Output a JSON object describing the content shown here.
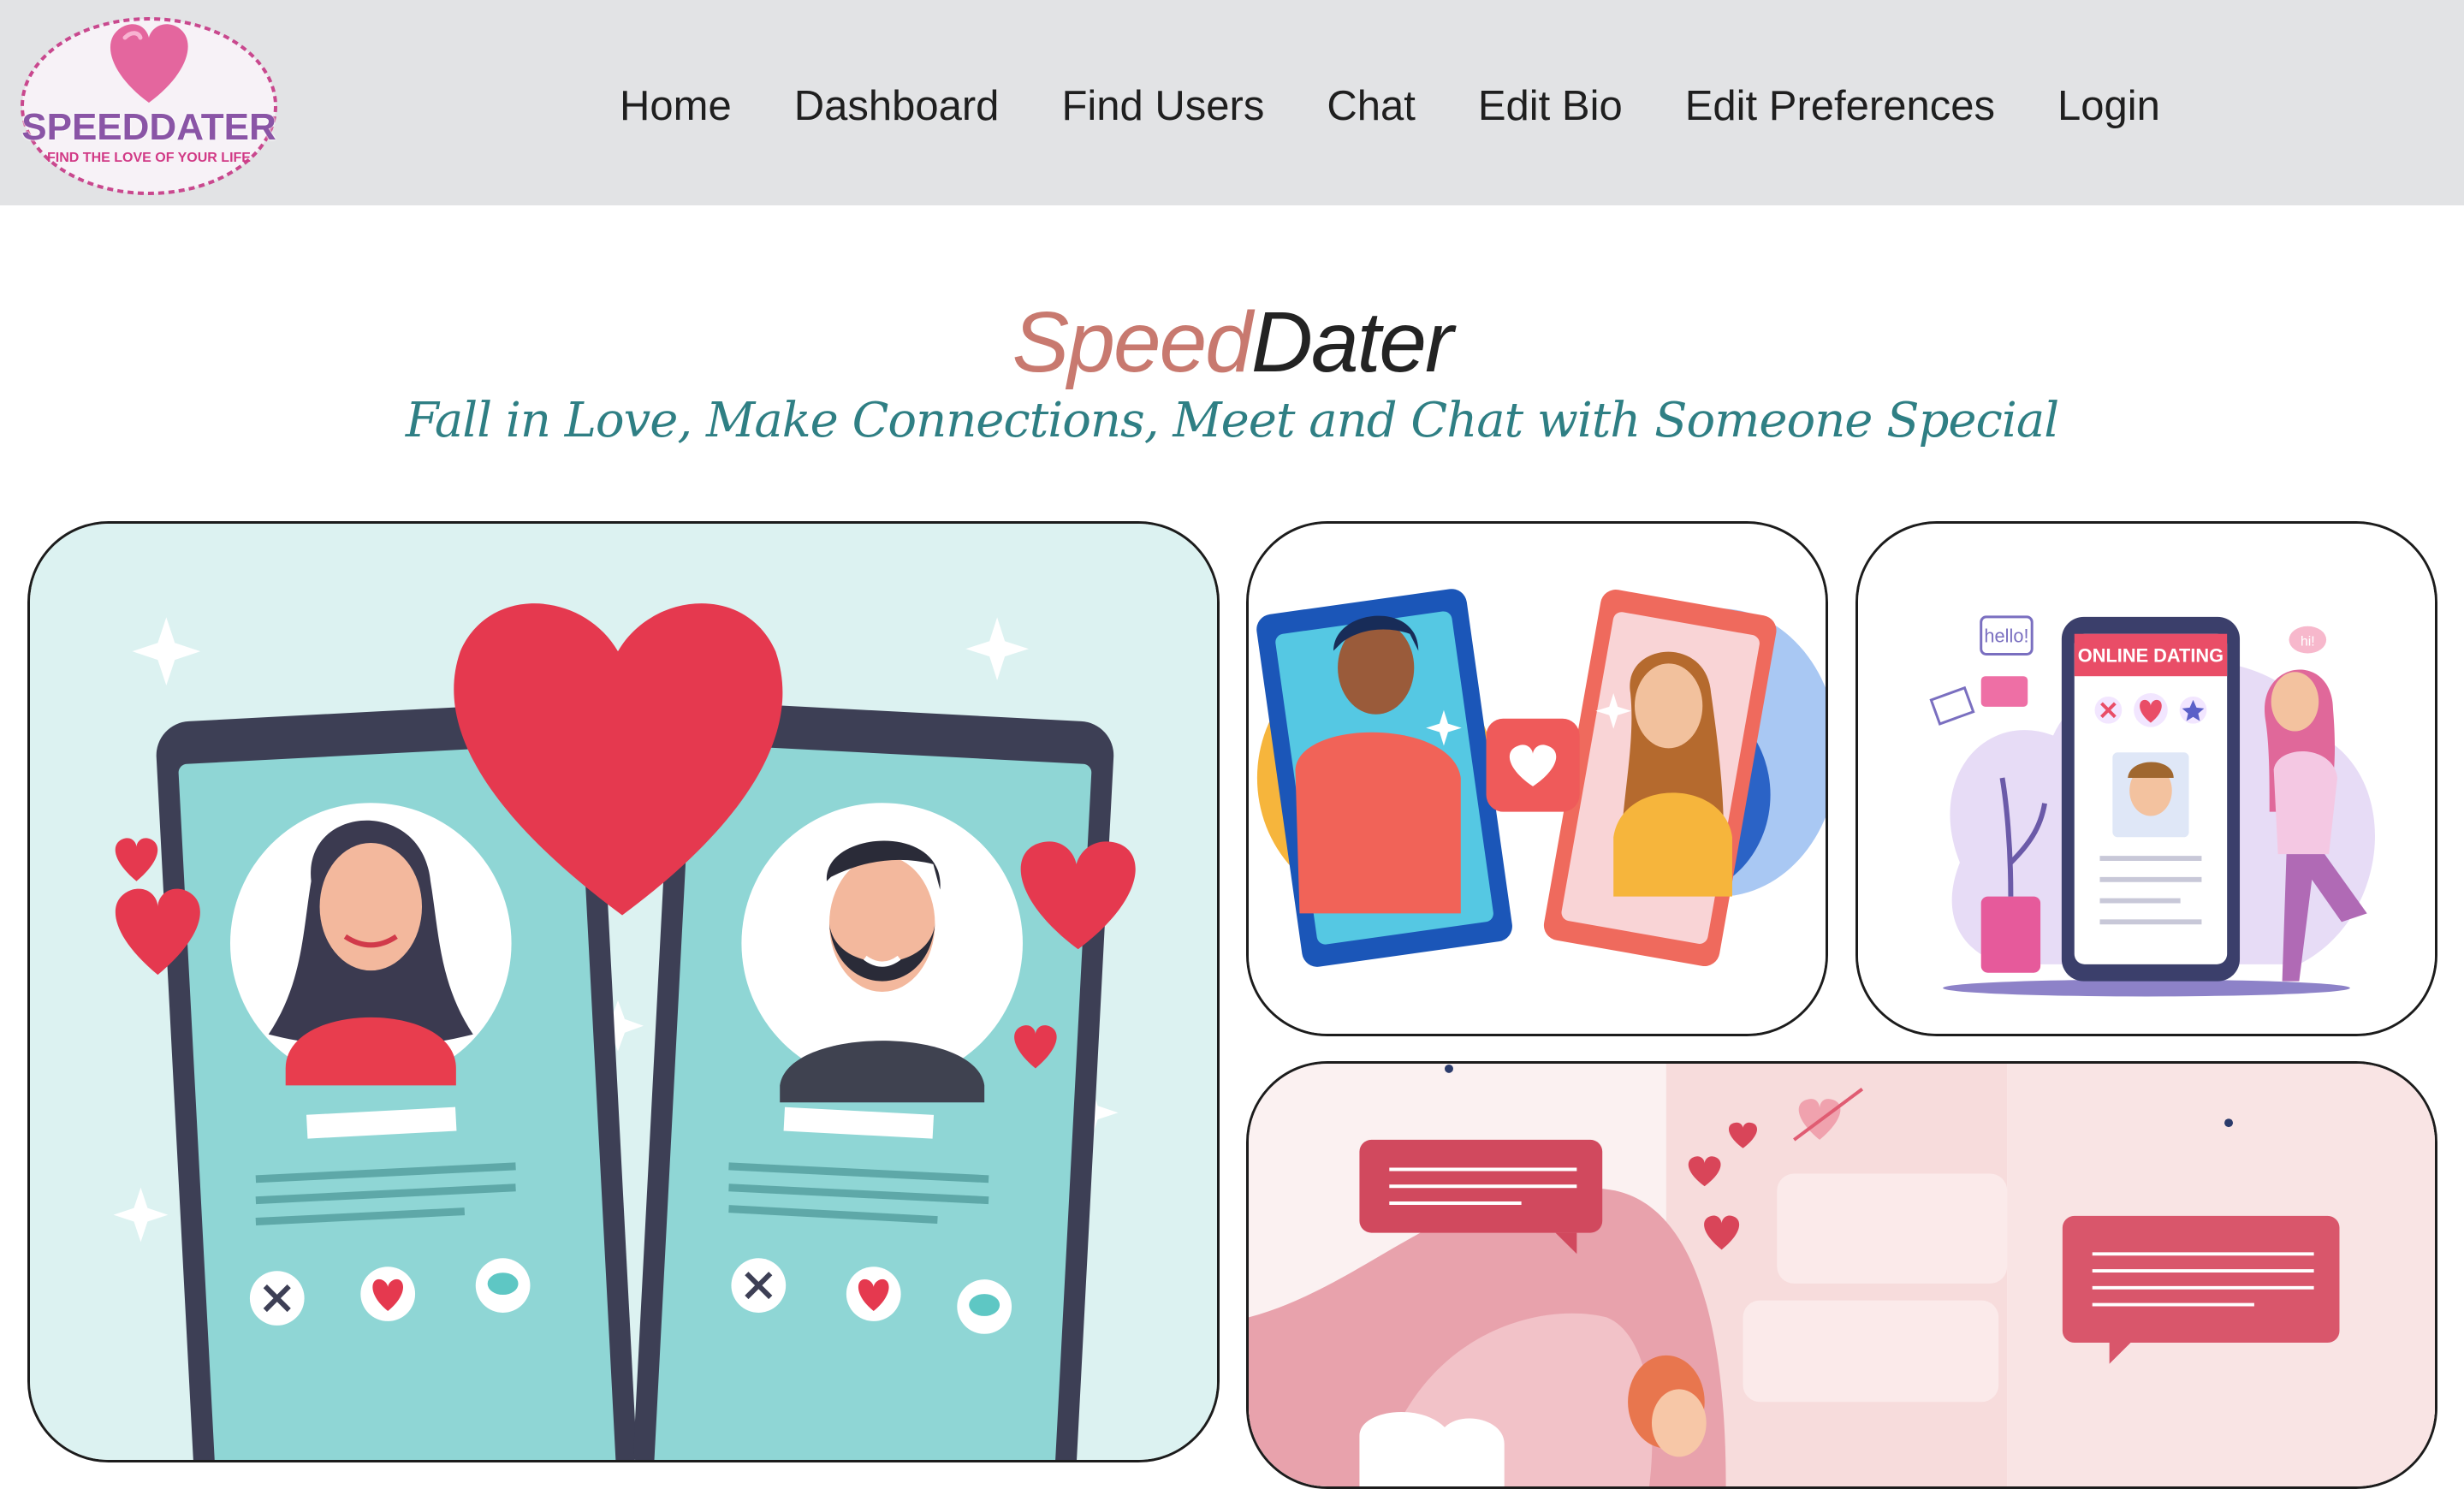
{
  "logo": {
    "brand": "SPEEDDATER",
    "tagline": "FIND THE LOVE OF YOUR LIFE"
  },
  "nav": {
    "items": [
      {
        "label": "Home"
      },
      {
        "label": "Dashboard"
      },
      {
        "label": "Find Users"
      },
      {
        "label": "Chat"
      },
      {
        "label": "Edit Bio"
      },
      {
        "label": "Edit Preferences"
      },
      {
        "label": "Login"
      }
    ]
  },
  "hero": {
    "title_part1": "Speed",
    "title_part2": "Dater",
    "subtitle": "Fall in Love, Make Connections, Meet and Chat with Someone Special"
  },
  "illustrations": {
    "online_dating_label": "ONLINE DATING",
    "hello_bubble": "hello!",
    "hi_bubble": "hi!"
  },
  "colors": {
    "navbar_bg": "#e2e3e5",
    "title_speed": "#c8796f",
    "title_dater": "#232323",
    "subtitle": "#2f7f84",
    "heart": "#e5394f"
  }
}
